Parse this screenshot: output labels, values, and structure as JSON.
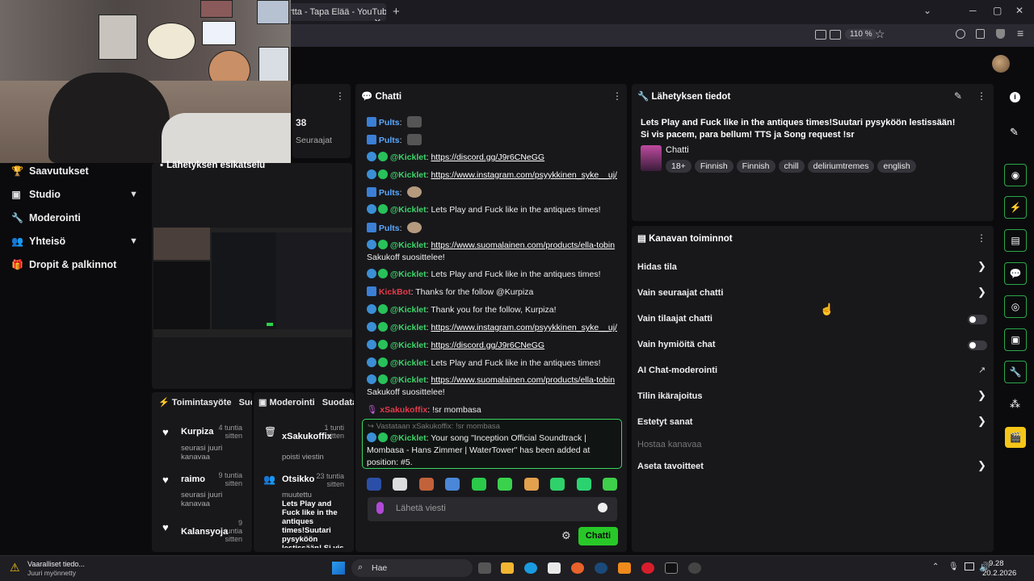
{
  "browser": {
    "tab_title": "rtta - Tapa Elää - YouTube",
    "zoom": "110 %",
    "new_tab": "+"
  },
  "sidebar": {
    "items": [
      {
        "label": "Saavutukset",
        "icon": "trophy-icon"
      },
      {
        "label": "Studio",
        "icon": "studio-icon"
      },
      {
        "label": "Moderointi",
        "icon": "wrench-icon"
      },
      {
        "label": "Yhteisö",
        "icon": "community-icon"
      },
      {
        "label": "Dropit & palkinnot",
        "icon": "gift-icon"
      }
    ]
  },
  "followers": {
    "count": "38",
    "label": "Seuraajat"
  },
  "preview": {
    "title": "Lähetyksen esikatselu"
  },
  "chat": {
    "title": "Chatti",
    "messages": [
      {
        "user": "Pults",
        "text": ""
      },
      {
        "user": "Pults",
        "text": ""
      },
      {
        "user": "@Kicklet",
        "text": "https://discord.gg/J9r6CNeGG"
      },
      {
        "user": "@Kicklet",
        "text": "https://www.instagram.com/psyykkinen_syke__uj/"
      },
      {
        "user": "Pults",
        "text": ""
      },
      {
        "user": "@Kicklet",
        "text": "Lets Play and Fuck like in the antiques times!"
      },
      {
        "user": "Pults",
        "text": ""
      },
      {
        "user": "@Kicklet",
        "text": "https://www.suomalainen.com/products/ella-tobin",
        "extra": "Sakukoff suosittelee!"
      },
      {
        "user": "@Kicklet",
        "text": "Lets Play and Fuck like in the antiques times!"
      },
      {
        "user": "KickBot",
        "text": "Thanks for the follow @Kurpiza"
      },
      {
        "user": "@Kicklet",
        "text": "Thank you for the follow, Kurpiza!"
      },
      {
        "user": "@Kicklet",
        "text": "https://www.instagram.com/psyykkinen_syke__uj/"
      },
      {
        "user": "@Kicklet",
        "text": "https://discord.gg/J9r6CNeGG"
      },
      {
        "user": "@Kicklet",
        "text": "Lets Play and Fuck like in the antiques times!"
      },
      {
        "user": "@Kicklet",
        "text": "https://www.suomalainen.com/products/ella-tobin",
        "extra": "Sakukoff suosittelee!"
      },
      {
        "user": "xSakukoffix",
        "text": "!sr mombasa"
      }
    ],
    "reply_to": "Vastataan xSakukoffix: !sr mombasa",
    "reply": {
      "user": "@Kicklet",
      "text": "Your song \"Inception Official Soundtrack | Mombasa - Hans Zimmer | WaterTower\" has been added at position: #5."
    },
    "input_placeholder": "Lähetä viesti",
    "send_label": "Chatti"
  },
  "stream_info": {
    "title": "Lähetyksen tiedot",
    "stream_title": "Lets Play and Fuck like in the antiques times!Suutari pysyköön lestissään! Si vis pacem, para bellum! TTS ja Song request !sr",
    "category": "Chatti",
    "tags": [
      "18+",
      "Finnish",
      "Finnish",
      "chill",
      "deliriumtremes",
      "english"
    ]
  },
  "channel_actions": {
    "title": "Kanavan toiminnot",
    "items": [
      {
        "label": "Hidas tila",
        "control": "chevron"
      },
      {
        "label": "Vain seuraajat chatti",
        "control": "chevron"
      },
      {
        "label": "Vain tilaajat chatti",
        "control": "toggle"
      },
      {
        "label": "Vain hymiöitä chat",
        "control": "toggle"
      },
      {
        "label": "AI Chat-moderointi",
        "control": "external"
      },
      {
        "label": "Tilin ikärajoitus",
        "control": "chevron"
      },
      {
        "label": "Estetyt sanat",
        "control": "chevron"
      },
      {
        "label": "Hostaa kanavaa",
        "control": "none"
      },
      {
        "label": "Aseta tavoitteet",
        "control": "chevron"
      }
    ]
  },
  "activity_feed": {
    "title": "Toimintasyöte",
    "title_suffix": "Suod",
    "items": [
      {
        "name": "Kurpiza",
        "sub": "seurasi juuri kanavaa",
        "time": "4 tuntia sitten"
      },
      {
        "name": "raimo",
        "sub": "seurasi juuri kanavaa",
        "time": "9 tuntia sitten"
      },
      {
        "name": "Kalansyoja",
        "sub": "",
        "time": "9 tuntia sitten"
      }
    ]
  },
  "mod_feed": {
    "title": "Moderointi",
    "title_suffix": "Suodata",
    "items": [
      {
        "name": "xSakukoffix",
        "sub": "poisti viestin",
        "time": "1 tunti sitten"
      },
      {
        "name": "Otsikko",
        "sub": "muutettu",
        "detail": "Lets Play and Fuck like in the antiques times!Suutari pysyköön lestissään! Si vis pacem, para",
        "time": "23 tuntia sitten"
      }
    ]
  },
  "taskbar": {
    "warning_title": "Vaaralliset tiedo...",
    "warning_sub": "Juuri myönnetty",
    "search": "Hae",
    "time": "9.28",
    "date": "20.2.2026"
  }
}
